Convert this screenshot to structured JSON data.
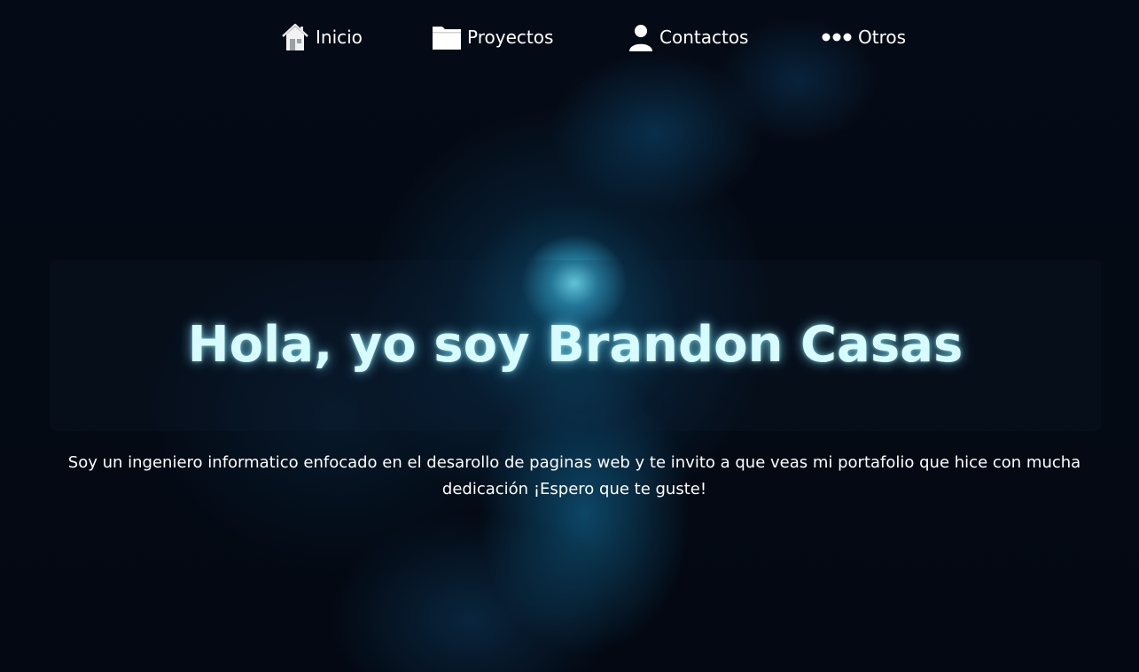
{
  "nav": {
    "items": [
      {
        "label": "Inicio",
        "icon": "home-icon"
      },
      {
        "label": "Proyectos",
        "icon": "folder-icon"
      },
      {
        "label": "Contactos",
        "icon": "user-icon"
      },
      {
        "label": "Otros",
        "icon": "more-dots-icon"
      }
    ]
  },
  "hero": {
    "title": "Hola, yo soy Brandon Casas",
    "description": "Soy un ingeniero informatico enfocado en el desarollo de paginas web y te invito a que veas mi portafolio que hice con mucha dedicación ¡Espero que te guste!"
  },
  "colors": {
    "background": "#030810",
    "title_glow": "#d8fbff",
    "accent_glow": "#4fd6f0"
  }
}
